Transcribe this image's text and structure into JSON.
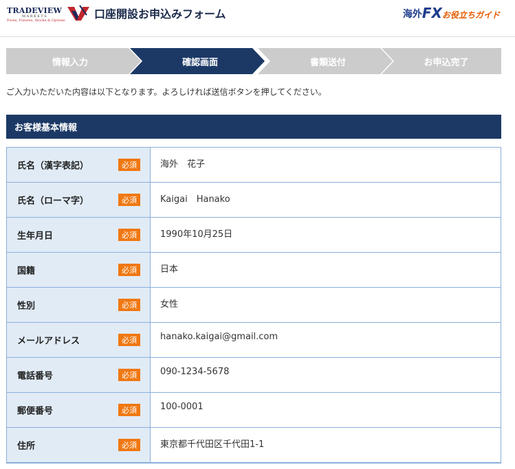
{
  "header": {
    "brand": {
      "name": "TRADEVIEW",
      "sub": "MARKETS",
      "tagline": "Forex, Futures, Stocks & Options"
    },
    "title": "口座開設お申込みフォーム",
    "guide": {
      "part1": "海外",
      "part2": "FX",
      "part3": "お役立ちガイド"
    }
  },
  "steps": [
    {
      "label": "情報入力"
    },
    {
      "label": "確認画面"
    },
    {
      "label": "書類送付"
    },
    {
      "label": "お申込完了"
    }
  ],
  "instructions": "ご入力いただいた内容は以下となります。よろしければ送信ボタンを押してください。",
  "section": {
    "title": "お客様基本情報"
  },
  "required_label": "必須",
  "rows": [
    {
      "label": "氏名（漢字表記）",
      "value": "海外　花子"
    },
    {
      "label": "氏名（ローマ字）",
      "value": "Kaigai　Hanako"
    },
    {
      "label": "生年月日",
      "value": "1990年10月25日"
    },
    {
      "label": "国籍",
      "value": "日本"
    },
    {
      "label": "性別",
      "value": "女性"
    },
    {
      "label": "メールアドレス",
      "value": "hanako.kaigai@gmail.com"
    },
    {
      "label": "電話番号",
      "value": "090-1234-5678"
    },
    {
      "label": "郵便番号",
      "value": "100-0001"
    },
    {
      "label": "住所",
      "value": "東京都千代田区千代田1-1"
    }
  ],
  "colors": {
    "navy": "#1c3966",
    "required": "#f07812",
    "label_bg": "#e1ebf6",
    "border": "#8aaedc",
    "step_inactive": "#cccccc"
  }
}
